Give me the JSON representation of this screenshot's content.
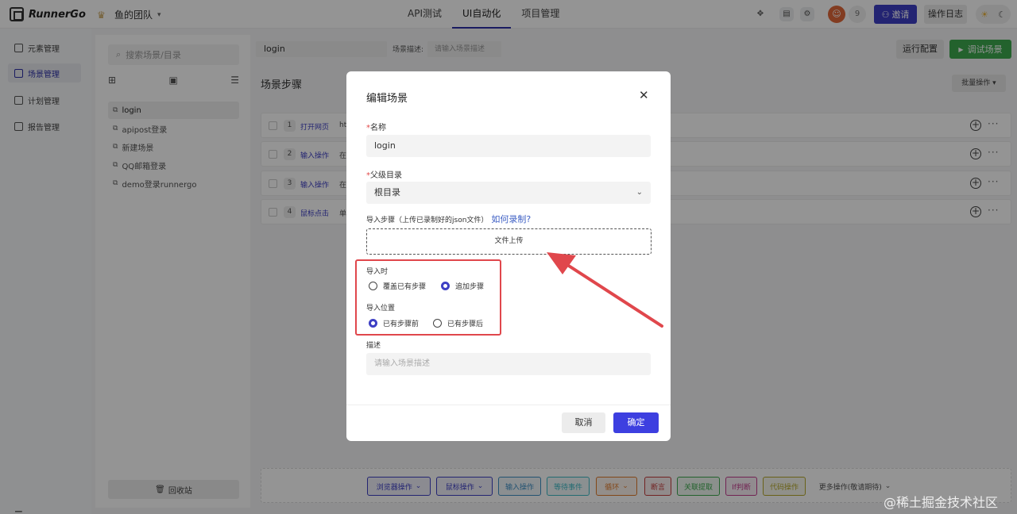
{
  "app": {
    "logo_text": "RunnerGo",
    "team_name": "鱼的团队"
  },
  "topnav": {
    "items": [
      "API测试",
      "UI自动化",
      "项目管理"
    ],
    "active": "UI自动化"
  },
  "topbar": {
    "avatar_count": "9",
    "invite_label": "邀请",
    "oplog_label": "操作日志"
  },
  "leftnav": {
    "items": [
      "元素管理",
      "场景管理",
      "计划管理",
      "报告管理"
    ],
    "active": "场景管理"
  },
  "tree": {
    "search_placeholder": "搜索场景/目录",
    "items": [
      "login",
      "apipost登录",
      "新建场景",
      "QQ邮箱登录",
      "demo登录runnergo"
    ],
    "recycle_label": "回收站"
  },
  "main": {
    "scene_name": "login",
    "desc_label": "场景描述:",
    "desc_placeholder": "请输入场景描述",
    "run_config_label": "运行配置",
    "debug_label": "调试场景",
    "steps_title": "场景步骤",
    "batch_label": "批量操作",
    "steps": [
      {
        "num": "1",
        "type": "打开网页",
        "value": "htt"
      },
      {
        "num": "2",
        "type": "输入操作",
        "value": "在"
      },
      {
        "num": "3",
        "type": "输入操作",
        "value": "在"
      },
      {
        "num": "4",
        "type": "鼠标点击",
        "value": "单"
      }
    ],
    "actions": [
      {
        "label": "浏览器操作",
        "color": "#3d3fc4",
        "dropdown": true
      },
      {
        "label": "鼠标操作",
        "color": "#3d3fc4",
        "dropdown": true
      },
      {
        "label": "输入操作",
        "color": "#3d8fc4",
        "dropdown": false
      },
      {
        "label": "等待事件",
        "color": "#3db8c4",
        "dropdown": false
      },
      {
        "label": "循环",
        "color": "#e07a2a",
        "dropdown": true
      },
      {
        "label": "断言",
        "color": "#c43d3d",
        "dropdown": false
      },
      {
        "label": "关联提取",
        "color": "#3daa4f",
        "dropdown": false
      },
      {
        "label": "If判断",
        "color": "#c43d8f",
        "dropdown": false
      },
      {
        "label": "代码操作",
        "color": "#b5a82a",
        "dropdown": false
      }
    ],
    "more_actions_label": "更多操作(敬请期待)"
  },
  "modal": {
    "title": "编辑场景",
    "name_label": "名称",
    "name_value": "login",
    "parent_label": "父级目录",
    "parent_value": "根目录",
    "import_label": "导入步骤（上传已录制好的json文件）",
    "how_link": "如何录制?",
    "upload_label": "文件上传",
    "import_when_label": "导入时",
    "import_when_options": [
      "覆盖已有步骤",
      "追加步骤"
    ],
    "import_when_selected": "追加步骤",
    "import_pos_label": "导入位置",
    "import_pos_options": [
      "已有步骤前",
      "已有步骤后"
    ],
    "import_pos_selected": "已有步骤前",
    "desc_label": "描述",
    "desc_placeholder": "请输入场景描述",
    "cancel_label": "取消",
    "ok_label": "确定"
  },
  "watermark": "@稀土掘金技术社区",
  "colors": {
    "accent": "#3d3fc4",
    "success": "#3daa4f",
    "highlight": "#e0474c"
  }
}
